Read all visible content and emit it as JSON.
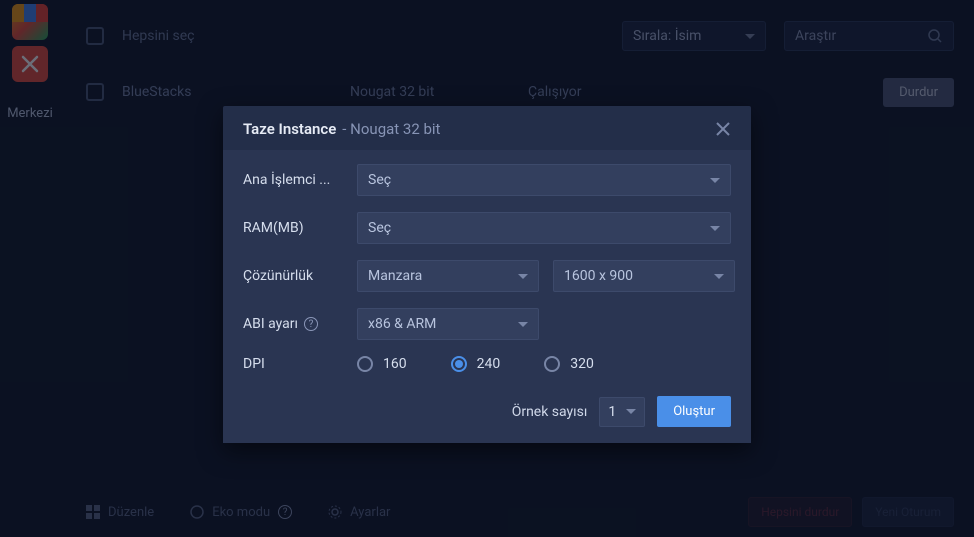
{
  "sidebar": {
    "merkezi_label": "Merkezi"
  },
  "header": {
    "select_all": "Hepsini seç",
    "sort_label": "Sırala: İsim",
    "search_placeholder": "Araştır"
  },
  "instance_row": {
    "name": "BlueStacks",
    "type": "Nougat 32 bit",
    "status": "Çalışıyor",
    "stop_label": "Durdur"
  },
  "modal": {
    "title": "Taze Instance",
    "subtitle": "- Nougat 32 bit",
    "cpu_label": "Ana İşlemci ...",
    "cpu_value": "Seç",
    "ram_label": "RAM(MB)",
    "ram_value": "Seç",
    "resolution_label": "Çözünürlük",
    "resolution_orientation": "Manzara",
    "resolution_size": "1600 x 900",
    "abi_label": "ABI ayarı",
    "abi_value": "x86 & ARM",
    "dpi_label": "DPI",
    "dpi_options": {
      "opt1": "160",
      "opt2": "240",
      "opt3": "320"
    },
    "instance_count_label": "Örnek sayısı",
    "instance_count_value": "1",
    "create_label": "Oluştur"
  },
  "bottom": {
    "arrange": "Düzenle",
    "eco_mode": "Eko modu",
    "settings": "Ayarlar",
    "stop_all": "Hepsini durdur",
    "new_session": "Yeni Oturum"
  }
}
